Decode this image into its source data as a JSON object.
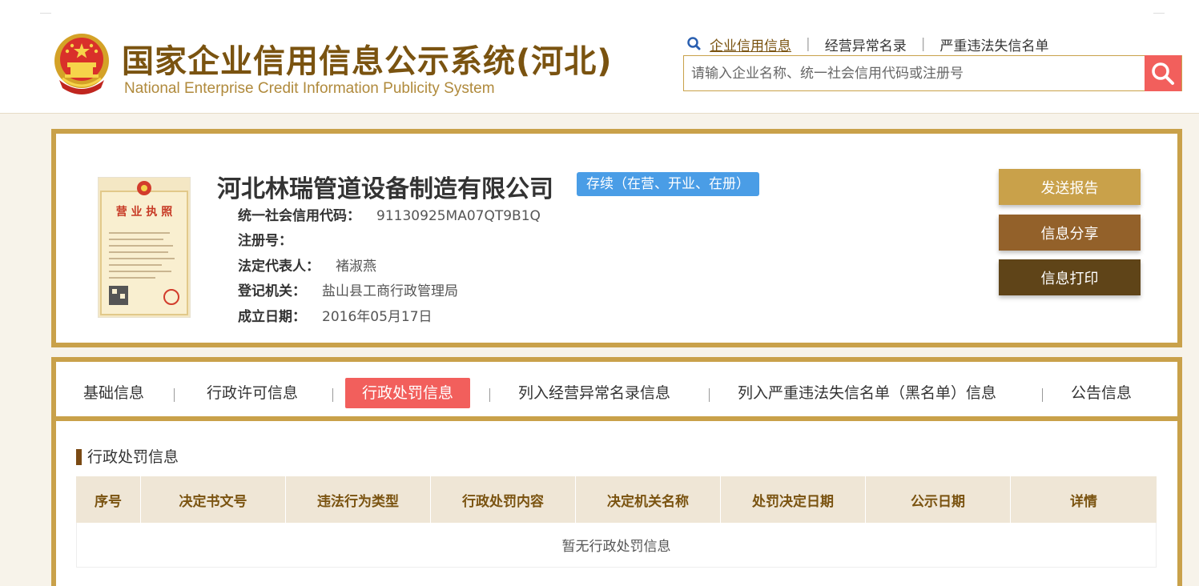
{
  "header": {
    "title": "国家企业信用信息公示系统(河北)",
    "subtitle": "National Enterprise Credit Information Publicity System",
    "links": [
      "企业信用信息",
      "经营异常名录",
      "严重违法失信名单"
    ],
    "search_placeholder": "请输入企业名称、统一社会信用代码或注册号"
  },
  "company": {
    "name": "河北林瑞管道设备制造有限公司",
    "status": "存续（在营、开业、在册）",
    "fields": [
      {
        "label": "统一社会信用代码：",
        "value": "91130925MA07QT9B1Q"
      },
      {
        "label": "注册号：",
        "value": ""
      },
      {
        "label": "法定代表人：",
        "value": "褚淑燕"
      },
      {
        "label": "登记机关：",
        "value": "盐山县工商行政管理局"
      },
      {
        "label": "成立日期：",
        "value": "2016年05月17日"
      }
    ],
    "license_text": "营 业 执 照"
  },
  "actions": {
    "send_report": "发送报告",
    "share": "信息分享",
    "print": "信息打印"
  },
  "tabs": [
    "基础信息",
    "行政许可信息",
    "行政处罚信息",
    "列入经营异常名录信息",
    "列入严重违法失信名单（黑名单）信息",
    "公告信息"
  ],
  "active_tab": "行政处罚信息",
  "section": {
    "title": "行政处罚信息",
    "columns": [
      "序号",
      "决定书文号",
      "违法行为类型",
      "行政处罚内容",
      "决定机关名称",
      "处罚决定日期",
      "公示日期",
      "详情"
    ],
    "empty_text": "暂无行政处罚信息"
  },
  "colors": {
    "gold": "#c9a14a",
    "brown": "#7a5310",
    "accent_red": "#f25f5c",
    "status_blue": "#4a9de6"
  }
}
